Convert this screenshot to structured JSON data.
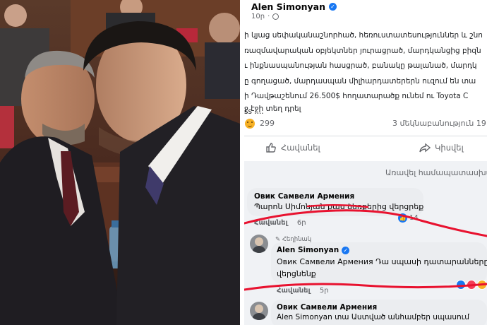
{
  "post": {
    "author": "Alen Simonyan",
    "time": "10ր",
    "body_lines": [
      "ի կյաց սեփականաշնորհած, հեռուստատեսություններ և շնո",
      "ռազմավարական օբյեկտներ յուրացրած, մարդկանցից բիզն",
      "ւ ինքնասպանության հասցրած, բանակը թալանած, մարդկ",
      "ը գողացած, մարդասպան միլիարդատերերն ուզում են տա",
      "ի Դավթաշենում 26.500$ հողատարածք ունեմ ու Toyota C",
      "ss ....",
      "ջ էջի տեղ դրել"
    ],
    "reaction_count": "299",
    "shares": "3 մեկնաբանություն 19",
    "like_label": "Հավանել",
    "share_label": "Կիսվել",
    "sort_label": "Առավել համապատասխան"
  },
  "comments": [
    {
      "name": "Овик Самвели Армения",
      "text": "Պարոն Սիմոնյան քաս ձեռքերից վերցրեք",
      "like": "Հավանել",
      "time": "6ր",
      "reaction_count": "14"
    },
    {
      "pinned_label": "Հեղինակ",
      "name": "Alen Simonyan",
      "text_line1": "Овик Самвели Армения Դա սպասի դատարանները",
      "text_line2": "վերցնենք",
      "like": "Հավանել",
      "time": "5ր"
    },
    {
      "name": "Овик Самвели Армения",
      "text": "Alen Simonyan տա Աստված անհամբեր սպասում"
    }
  ],
  "colors": {
    "accent": "#1877f2",
    "annotation": "#e8122f",
    "panel_bg": "#f0f2f5"
  }
}
